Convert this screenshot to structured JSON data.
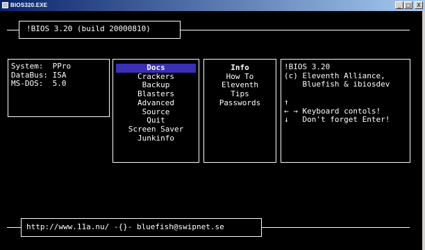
{
  "window": {
    "title": "BIOS320.EXE",
    "buttons": {
      "minimize": "_",
      "maximize": "□",
      "close": "X"
    }
  },
  "header": {
    "title": "!BIOS 3.20 (build 20000810)"
  },
  "system": {
    "lines": [
      "System:  PPro",
      "DataBus: ISA",
      "MS-DOS:  5.0"
    ]
  },
  "menu": {
    "items": [
      {
        "label": "Docs",
        "selected": true
      },
      {
        "label": "Crackers"
      },
      {
        "label": "Backup"
      },
      {
        "label": "Blasters"
      },
      {
        "label": "Advanced"
      },
      {
        "label": "Source"
      },
      {
        "label": "Quit"
      },
      {
        "label": "Screen Saver"
      },
      {
        "label": "Junkinfo"
      }
    ]
  },
  "info": {
    "items": [
      "Info",
      "How To",
      "Eleventh",
      "Tips",
      "Passwords"
    ]
  },
  "about": {
    "lines": [
      "!BIOS 3.20",
      "(c) Eleventh Alliance,",
      "    Bluefish & ibiosdev",
      "",
      "",
      "↑",
      "← → Keyboard contols!",
      "↓   Don't forget Enter!"
    ]
  },
  "footer": {
    "text": "http://www.11a.nu/ -{}- bluefish@swipnet.se"
  },
  "colors": {
    "selected_bg": "#3b2fb5",
    "titlebar_start": "#0a246a",
    "titlebar_end": "#a6caf0"
  }
}
